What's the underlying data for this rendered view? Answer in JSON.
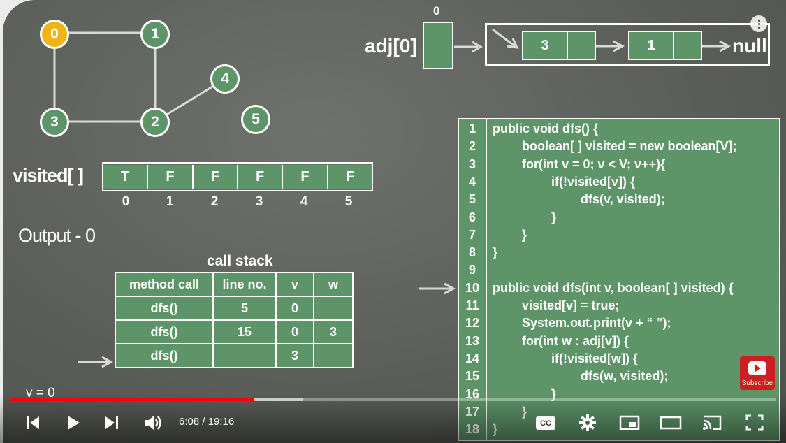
{
  "graph": {
    "nodes": [
      "0",
      "1",
      "2",
      "3",
      "4",
      "5"
    ],
    "active_node": "0"
  },
  "adjacency": {
    "label": "adj[0]",
    "index": "0",
    "list_values": [
      "3",
      "1"
    ],
    "terminal": "null"
  },
  "visited": {
    "label": "visited[ ]",
    "values": [
      "T",
      "F",
      "F",
      "F",
      "F",
      "F"
    ],
    "indices": [
      "0",
      "1",
      "2",
      "3",
      "4",
      "5"
    ]
  },
  "output_text": "Output - 0",
  "call_stack": {
    "title": "call stack",
    "headers": [
      "method call",
      "line no.",
      "v",
      "w"
    ],
    "rows": [
      [
        "dfs()",
        "5",
        "0",
        ""
      ],
      [
        "dfs()",
        "15",
        "0",
        "3"
      ],
      [
        "dfs()",
        "",
        "3",
        ""
      ]
    ]
  },
  "variable_text": "v = 0",
  "code": {
    "line_numbers": [
      "1",
      "2",
      "3",
      "4",
      "5",
      "6",
      "7",
      "8",
      "9",
      "10",
      "11",
      "12",
      "13",
      "14",
      "15",
      "16",
      "17",
      "18"
    ],
    "lines": [
      "public void dfs() {",
      "boolean[ ] visited = new boolean[V];",
      "for(int v = 0; v < V; v++){",
      "if(!visited[v]) {",
      "dfs(v, visited);",
      "}",
      "}",
      "}",
      "",
      "public void dfs(int v, boolean[ ] visited) {",
      "visited[v] = true;",
      "System.out.print(v + “ ”);",
      "for(int w : adj[v]) {",
      "if(!visited[w]) {",
      "dfs(w, visited);",
      "}",
      "}",
      "}"
    ]
  },
  "player": {
    "time_display": "6:08 / 19:16",
    "progress": 0.318,
    "buffered": 0.382,
    "subscribe_label": "Subscribe",
    "cc_label": "CC",
    "accent_color": "#ff0000"
  },
  "colors": {
    "board": "#5c5f59",
    "cell_green": "#5d9468",
    "active_node": "#f2b316"
  }
}
